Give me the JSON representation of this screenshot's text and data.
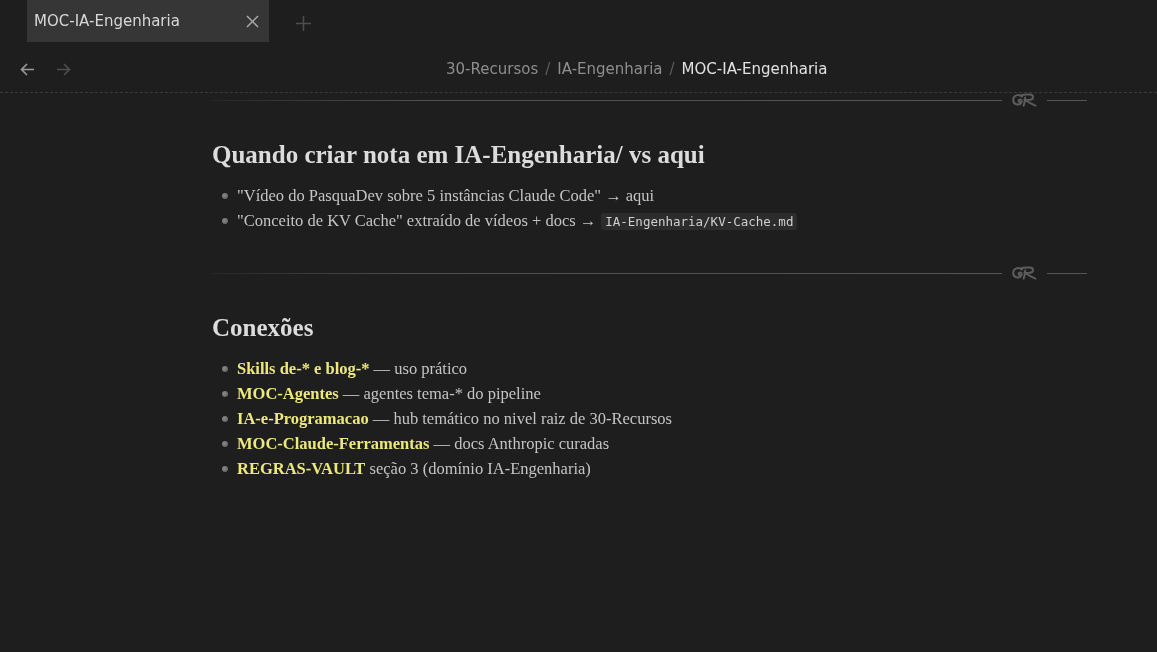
{
  "tabs": [
    {
      "label": "MOC-IA-Engenharia",
      "selected": true
    }
  ],
  "navigation": [
    {
      "kind": "back",
      "disabled": false
    },
    {
      "kind": "forward",
      "disabled": true
    }
  ],
  "breadcrumb": [
    {
      "kind": "crumb",
      "label": "30-Recursos",
      "current": false
    },
    {
      "kind": "separator",
      "label": "/"
    },
    {
      "kind": "crumb",
      "label": "IA-Engenharia",
      "current": false
    },
    {
      "kind": "separator",
      "label": "/"
    },
    {
      "kind": "crumb",
      "label": "MOC-IA-Engenharia",
      "current": true
    }
  ],
  "sections": [
    {
      "heading": "Quando criar nota em IA-Engenharia/ vs aqui",
      "items": [
        {
          "text": "\"Vídeo do PasquaDev sobre 5 instâncias Claude Code\" → aqui"
        },
        {
          "text": "\"Conceito de KV Cache\" extraído de vídeos + docs →",
          "code": "IA-Engenharia/KV-Cache.md"
        }
      ]
    },
    {
      "heading": "Conexões",
      "items": [
        {
          "link": "Skills de-* e blog-*",
          "text": "— uso prático"
        },
        {
          "link": "MOC-Agentes",
          "text": "— agentes tema-* do pipeline"
        },
        {
          "link": "IA-e-Programacao",
          "text": "— hub temático no nivel raiz de 30-Recursos"
        },
        {
          "link": "MOC-Claude-Ferramentas",
          "text": "— docs Anthropic curadas"
        },
        {
          "link": "REGRAS-VAULT",
          "text": "seção 3 (domínio IA-Engenharia)"
        }
      ]
    }
  ]
}
